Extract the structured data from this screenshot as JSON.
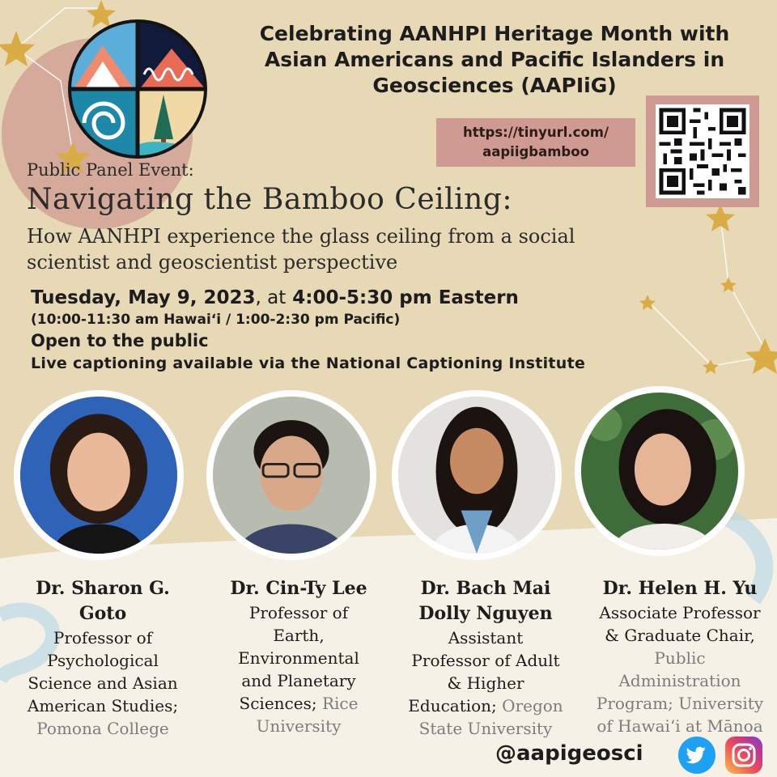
{
  "header": {
    "line1": "Celebrating AANHPI Heritage Month with",
    "line2": "Asian Americans and Pacific Islanders in",
    "line3": "Geosciences (AAPIiG)"
  },
  "link": {
    "line1": "https://tinyurl.com/",
    "line2": "aapiigbamboo"
  },
  "event": {
    "label": "Public Panel Event:",
    "title": "Navigating the Bamboo Ceiling:",
    "subtitle_line1": "How AANHPI experience the glass ceiling from a social",
    "subtitle_line2": "scientist and geoscientist perspective",
    "date_day": "Tuesday,",
    "date_main": "May 9, 2023",
    "date_at": ", at",
    "date_time": "4:00-5:30 pm Eastern",
    "alt_times": "(10:00-11:30 am Hawaiʻi / 1:00-2:30 pm Pacific)",
    "open": "Open to the public",
    "captioning": "Live captioning available via the National Captioning Institute"
  },
  "panelists": [
    {
      "name_line1": "Dr. Sharon G.",
      "name_line2": "Goto",
      "role_lines": [
        "Professor of",
        "Psychological",
        "Science and Asian",
        "American Studies;"
      ],
      "institution_lines": [
        "Pomona College"
      ]
    },
    {
      "name_line1": "Dr. Cin-Ty Lee",
      "role_lines": [
        "Professor of",
        "Earth,",
        "Environmental",
        "and Planetary"
      ],
      "role_tail": "Sciences;",
      "institution_inline": "Rice",
      "institution_lines": [
        "University"
      ]
    },
    {
      "name_line1": "Dr. Bach Mai",
      "name_line2": "Dolly Nguyen",
      "role_lines": [
        "Assistant",
        "Professor of Adult",
        "& Higher"
      ],
      "role_tail": "Education;",
      "institution_inline": "Oregon",
      "institution_lines": [
        "State University"
      ]
    },
    {
      "name_line1": "Dr. Helen H. Yu",
      "role_lines": [
        "Associate Professor",
        "& Graduate Chair,"
      ],
      "program_lines": [
        "Public",
        "Administration"
      ],
      "program_tail": "Program;",
      "institution_inline": "University",
      "institution_lines": [
        "of Hawaiʻi at Mānoa"
      ]
    }
  ],
  "social": {
    "handle": "@aapigeosci",
    "icons": [
      "twitter-icon",
      "instagram-icon"
    ]
  },
  "colors": {
    "background": "#e7d9b5",
    "accent_pink": "#cf9a92",
    "star": "#d9ac45",
    "twitter": "#1da1f2"
  }
}
